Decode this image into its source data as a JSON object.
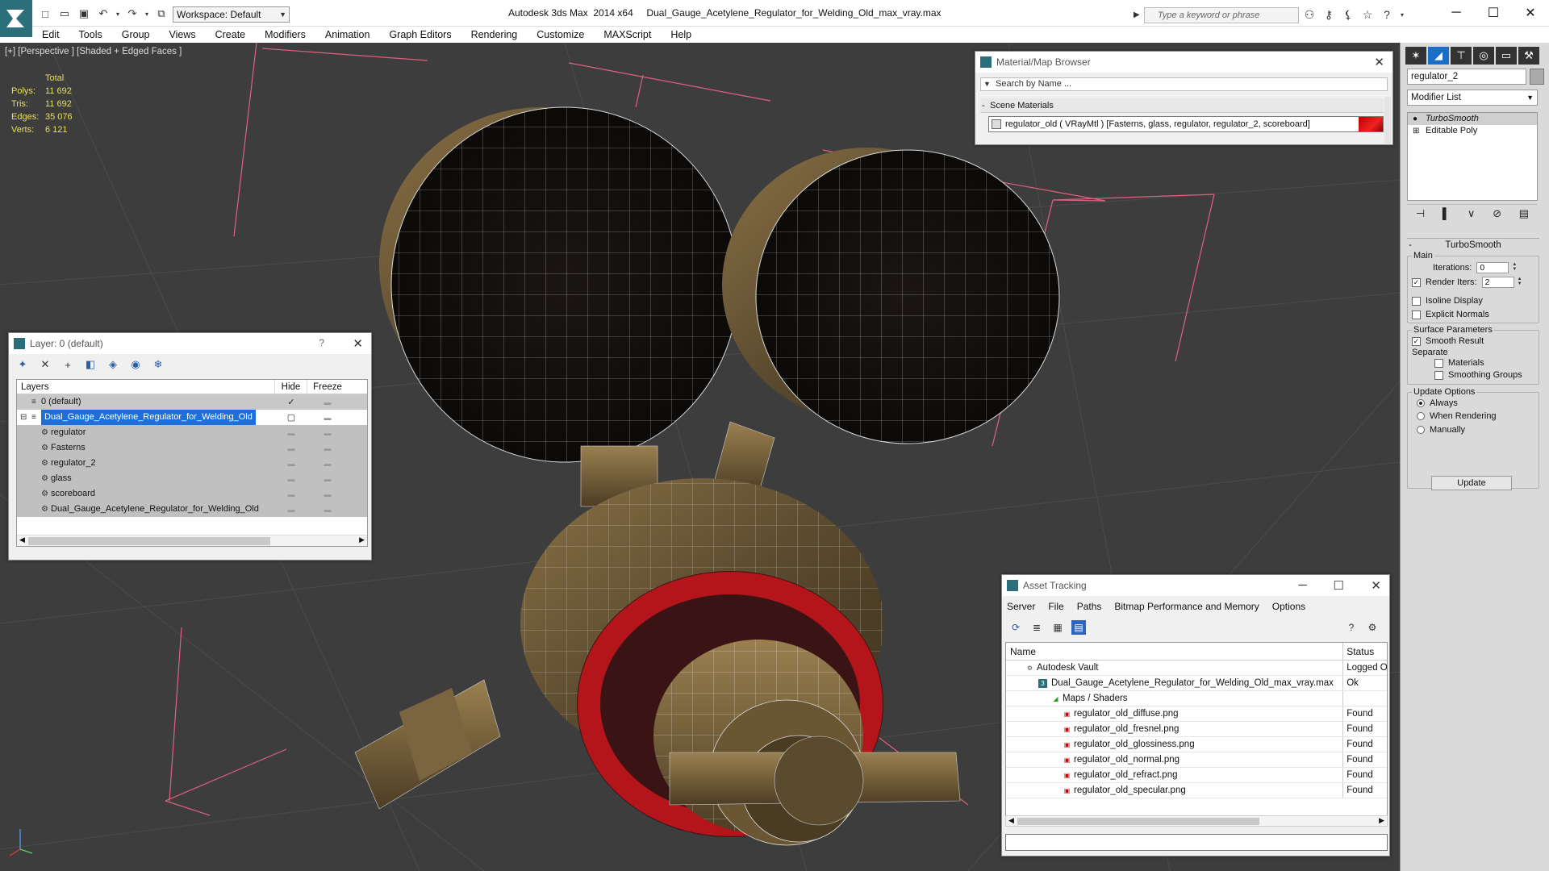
{
  "titlebar": {
    "workspace_label": "Workspace: Default",
    "title": "Autodesk 3ds Max  2014 x64     Dual_Gauge_Acetylene_Regulator_for_Welding_Old_max_vray.max",
    "search_placeholder": "Type a keyword or phrase"
  },
  "menubar": {
    "items": [
      "Edit",
      "Tools",
      "Group",
      "Views",
      "Create",
      "Modifiers",
      "Animation",
      "Graph Editors",
      "Rendering",
      "Customize",
      "MAXScript",
      "Help"
    ]
  },
  "viewport": {
    "label": "[+] [Perspective ] [Shaded + Edged Faces ]",
    "stats": {
      "total_label": "Total",
      "rows": [
        {
          "key": "Polys:",
          "value": "11 692"
        },
        {
          "key": "Tris:",
          "value": "11 692"
        },
        {
          "key": "Edges:",
          "value": "35 076"
        },
        {
          "key": "Verts:",
          "value": "6 121"
        }
      ]
    },
    "colors": {
      "background": "#3d3d3d",
      "grid": "#4a4a4a",
      "bbox": "#e06080",
      "stats": "#e6e05a"
    }
  },
  "layer_window": {
    "title": "Layer: 0 (default)",
    "help": "?",
    "columns": {
      "layers": "Layers",
      "hide": "Hide",
      "freeze": "Freeze"
    },
    "rows": [
      {
        "name": "0 (default)",
        "indent": 0
      },
      {
        "name": "Dual_Gauge_Acetylene_Regulator_for_Welding_Old",
        "indent": 1
      },
      {
        "name": "regulator",
        "indent": 2
      },
      {
        "name": "Fasterns",
        "indent": 2
      },
      {
        "name": "regulator_2",
        "indent": 2
      },
      {
        "name": "glass",
        "indent": 2
      },
      {
        "name": "scoreboard",
        "indent": 2
      },
      {
        "name": "Dual_Gauge_Acetylene_Regulator_for_Welding_Old",
        "indent": 2
      }
    ]
  },
  "material_browser": {
    "title": "Material/Map Browser",
    "search_placeholder": "Search by Name ...",
    "section": "Scene Materials",
    "material": "regulator_old  ( VRayMtl ) [Fasterns, glass, regulator, regulator_2, scoreboard]"
  },
  "asset_tracking": {
    "title": "Asset Tracking",
    "menu": [
      "Server",
      "File",
      "Paths",
      "Bitmap Performance and Memory",
      "Options"
    ],
    "columns": {
      "name": "Name",
      "status": "Status"
    },
    "rows": [
      {
        "name": "Autodesk Vault",
        "status": "Logged O",
        "indent": 1,
        "icon": "vault"
      },
      {
        "name": "Dual_Gauge_Acetylene_Regulator_for_Welding_Old_max_vray.max",
        "status": "Ok",
        "indent": 2,
        "icon": "max"
      },
      {
        "name": "Maps / Shaders",
        "status": "",
        "indent": 3,
        "icon": "maps"
      },
      {
        "name": "regulator_old_diffuse.png",
        "status": "Found",
        "indent": 4,
        "icon": "png"
      },
      {
        "name": "regulator_old_fresnel.png",
        "status": "Found",
        "indent": 4,
        "icon": "png"
      },
      {
        "name": "regulator_old_glossiness.png",
        "status": "Found",
        "indent": 4,
        "icon": "png"
      },
      {
        "name": "regulator_old_normal.png",
        "status": "Found",
        "indent": 4,
        "icon": "png"
      },
      {
        "name": "regulator_old_refract.png",
        "status": "Found",
        "indent": 4,
        "icon": "png"
      },
      {
        "name": "regulator_old_specular.png",
        "status": "Found",
        "indent": 4,
        "icon": "png"
      }
    ]
  },
  "command_panel": {
    "object_name": "regulator_2",
    "modifier_list": "Modifier List",
    "stack": [
      "TurboSmooth",
      "Editable Poly"
    ],
    "turbosmooth": {
      "header": "TurboSmooth",
      "main_label": "Main",
      "iterations_label": "Iterations:",
      "iterations_value": "0",
      "render_iters_label": "Render Iters:",
      "render_iters_value": "2",
      "render_iters_checked": true,
      "isoline_label": "Isoline Display",
      "explicit_normals_label": "Explicit Normals",
      "surface_label": "Surface Parameters",
      "smooth_result_label": "Smooth Result",
      "separate_label": "Separate",
      "materials_label": "Materials",
      "smoothing_groups_label": "Smoothing Groups",
      "update_options_label": "Update Options",
      "always_label": "Always",
      "when_rendering_label": "When Rendering",
      "manually_label": "Manually",
      "update_button": "Update"
    }
  }
}
